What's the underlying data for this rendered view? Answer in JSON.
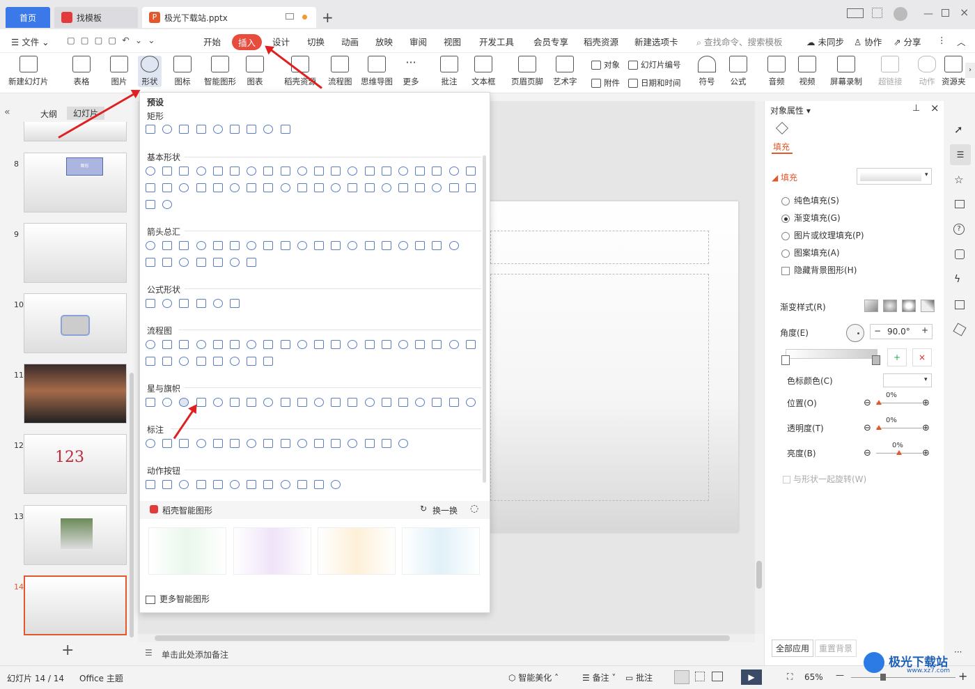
{
  "tabs": {
    "home": "首页",
    "template": "找模板",
    "doc": "极光下载站.pptx"
  },
  "menu": {
    "file": "文件",
    "items": [
      "开始",
      "插入",
      "设计",
      "切换",
      "动画",
      "放映",
      "审阅",
      "视图",
      "开发工具",
      "会员专享",
      "稻壳资源",
      "新建选项卡"
    ],
    "search": "查找命令、搜索模板",
    "sync": "未同步",
    "collab": "协作",
    "share": "分享"
  },
  "ribbon": {
    "new_slide": "新建幻灯片",
    "table": "表格",
    "picture": "图片",
    "shape": "形状",
    "icon": "图标",
    "smart": "智能图形",
    "chart": "图表",
    "docer": "稻壳资源",
    "flow": "流程图",
    "mind": "思维导图",
    "more": "更多",
    "comment": "批注",
    "textbox": "文本框",
    "header": "页眉页脚",
    "wordart": "艺术字",
    "object": "对象",
    "slide_num": "幻灯片编号",
    "attach": "附件",
    "datetime": "日期和时间",
    "symbol": "符号",
    "formula": "公式",
    "audio": "音频",
    "video": "视频",
    "record": "屏幕录制",
    "link": "超链接",
    "action": "动作",
    "resource": "资源夹"
  },
  "left": {
    "outline": "大纲",
    "slides": "幻灯片",
    "numbers": [
      "8",
      "9",
      "10",
      "11",
      "12",
      "13",
      "14"
    ],
    "thumb8_label": "图形",
    "thumb12_text": "123"
  },
  "shapes": {
    "preset": "预设",
    "rect": "矩形",
    "basic": "基本形状",
    "arrows": "箭头总汇",
    "formula": "公式形状",
    "flow": "流程图",
    "stars": "星与旗帜",
    "callout": "标注",
    "action": "动作按钮",
    "docer_smart": "稻壳智能图形",
    "swap": "换一换",
    "more_smart": "更多智能图形"
  },
  "notes": "单击此处添加备注",
  "right": {
    "title": "对象属性",
    "fill_tab": "填充",
    "fill_head": "填充",
    "solid": "纯色填充(S)",
    "gradient": "渐变填充(G)",
    "pic": "图片或纹理填充(P)",
    "pattern": "图案填充(A)",
    "hide_bg": "隐藏背景图形(H)",
    "grad_style": "渐变样式(R)",
    "angle": "角度(E)",
    "angle_val": "90.0°",
    "stop_color": "色标颜色(C)",
    "position": "位置(O)",
    "pos_val": "0%",
    "transparency": "透明度(T)",
    "trans_val": "0%",
    "brightness": "亮度(B)",
    "bright_val": "0%",
    "rotate": "与形状一起旋转(W)",
    "apply_all": "全部应用",
    "reset_bg": "重置背景"
  },
  "status": {
    "slide": "幻灯片 14 / 14",
    "theme": "Office 主题",
    "beautify": "智能美化",
    "notes": "备注",
    "comment": "批注",
    "zoom": "65%"
  },
  "watermark": {
    "text": "极光下载站",
    "url": "www.xz7.com"
  }
}
